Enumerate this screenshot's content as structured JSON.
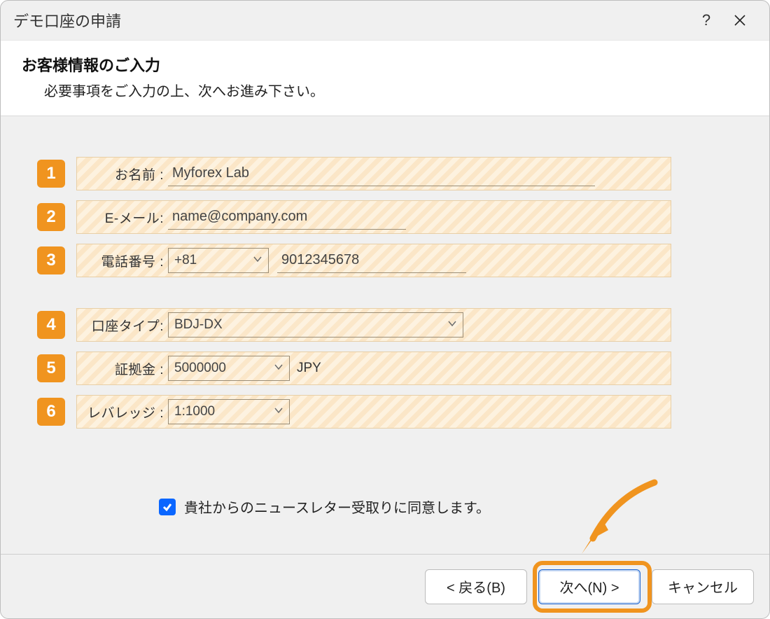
{
  "window": {
    "title": "デモ口座の申請"
  },
  "subheader": {
    "title": "お客様情報のご入力",
    "description": "必要事項をご入力の上、次へお進み下さい。"
  },
  "badges": [
    "1",
    "2",
    "3",
    "4",
    "5",
    "6"
  ],
  "fields": {
    "name": {
      "label": "お名前 :",
      "value": "Myforex Lab"
    },
    "email": {
      "label": "E-メール:",
      "value": "name@company.com"
    },
    "phone": {
      "label": "電話番号 :",
      "country_code": "+81",
      "value": "9012345678"
    },
    "account_type": {
      "label": "口座タイプ:",
      "value": "BDJ-DX"
    },
    "deposit": {
      "label": "証拠金 :",
      "value": "5000000",
      "currency": "JPY"
    },
    "leverage": {
      "label": "レバレッジ :",
      "value": "1:1000"
    }
  },
  "consent": {
    "checked": true,
    "label": "貴社からのニュースレター受取りに同意します。"
  },
  "buttons": {
    "back": "< 戻る(B)",
    "next": "次へ(N) >",
    "cancel": "キャンセル"
  },
  "titlebar": {
    "help": "?",
    "close": "×"
  }
}
